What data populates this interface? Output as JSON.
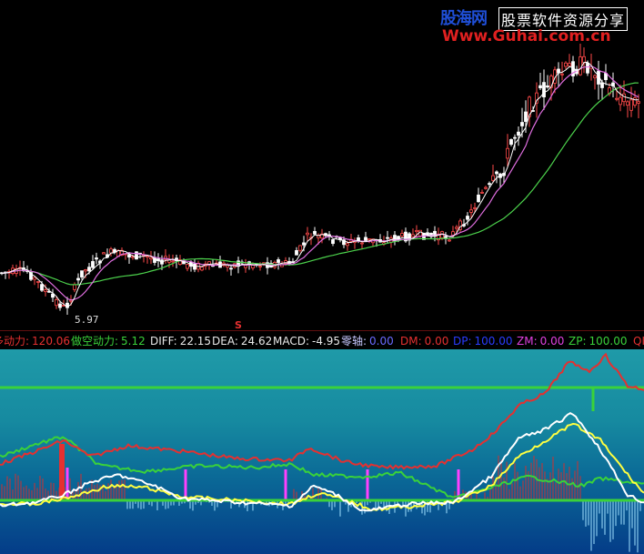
{
  "watermark": {
    "site_cn": "股海网",
    "tagline": "股票软件资源分享",
    "url": "Www.Guhai.com.cn"
  },
  "price_chart": {
    "low_label": "5.97",
    "signal_marker": "S",
    "colors": {
      "candle": "#ffffff",
      "ma_short": "#ffffff",
      "ma_mid": "#e06ee0",
      "ma_long": "#4cd24c"
    }
  },
  "indicator_bar": {
    "items": [
      {
        "label": "多动力:",
        "value": "120.06",
        "label_color": "#e53030",
        "value_color": "#e53030"
      },
      {
        "label": "做空动力:",
        "value": "5.12",
        "label_color": "#3ad23a",
        "value_color": "#3ad23a"
      },
      {
        "label": "DIFF:",
        "value": "22.15",
        "label_color": "#e8e8e8",
        "value_color": "#e8e8e8"
      },
      {
        "label": "DEA:",
        "value": "24.62",
        "label_color": "#e8e8e8",
        "value_color": "#e8e8e8"
      },
      {
        "label": "MACD:",
        "value": "-4.95",
        "label_color": "#e8e8e8",
        "value_color": "#e8e8e8"
      },
      {
        "label": "零轴:",
        "value": "0.00",
        "label_color": "#c8c8ff",
        "value_color": "#6a6aff"
      },
      {
        "label": "DM:",
        "value": "0.00",
        "label_color": "#e53030",
        "value_color": "#e53030"
      },
      {
        "label": "DP:",
        "value": "100.00",
        "label_color": "#2a3cff",
        "value_color": "#2a3cff"
      },
      {
        "label": "ZM:",
        "value": "0.00",
        "label_color": "#e040e0",
        "value_color": "#e040e0"
      },
      {
        "label": "ZP:",
        "value": "100.00",
        "label_color": "#3ad23a",
        "value_color": "#3ad23a"
      },
      {
        "label": "QI",
        "value": "",
        "label_color": "#e53030",
        "value_color": "#e53030"
      }
    ]
  },
  "oscillator": {
    "colors": {
      "bull_power": "#e53030",
      "bear_power": "#3ad23a",
      "diff": "#ffffff",
      "dea": "#ffff40",
      "zero_axis": "#3ad23a",
      "signal": "#ff40ff",
      "hist_pos": "#d03030",
      "hist_neg": "#a0e0ff"
    }
  }
}
